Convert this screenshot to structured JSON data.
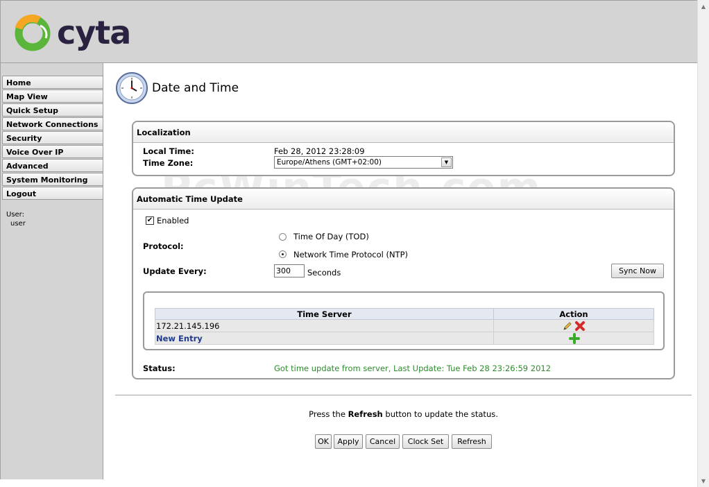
{
  "brand": {
    "logo_text": "cyta",
    "colors": {
      "green": "#5bb53a",
      "orange": "#f5a623",
      "navy": "#2a2240"
    }
  },
  "sidebar": {
    "items": [
      {
        "label": "Home"
      },
      {
        "label": "Map View"
      },
      {
        "label": "Quick Setup"
      },
      {
        "label": "Network Connections"
      },
      {
        "label": "Security"
      },
      {
        "label": "Voice Over IP"
      },
      {
        "label": "Advanced"
      },
      {
        "label": "System Monitoring"
      },
      {
        "label": "Logout"
      }
    ],
    "user_label": "User:",
    "user_name": "user"
  },
  "page": {
    "title": "Date and Time",
    "icon": "clock-icon"
  },
  "localization": {
    "heading": "Localization",
    "local_time_label": "Local Time:",
    "local_time_value": "Feb 28, 2012 23:28:09",
    "time_zone_label": "Time Zone:",
    "time_zone_value": "Europe/Athens (GMT+02:00)"
  },
  "automatic_update": {
    "heading": "Automatic Time Update",
    "enabled_label": "Enabled",
    "enabled_checked": true,
    "protocol_label": "Protocol:",
    "protocol_options": [
      {
        "label": "Time Of Day (TOD)",
        "selected": false
      },
      {
        "label": "Network Time Protocol (NTP)",
        "selected": true
      }
    ],
    "update_every_label": "Update Every:",
    "update_every_value": "300",
    "update_every_unit": "Seconds",
    "sync_now_label": "Sync Now",
    "table": {
      "headers": [
        "Time Server",
        "Action"
      ],
      "rows": [
        {
          "server": "172.21.145.196"
        }
      ],
      "new_entry_label": "New Entry"
    },
    "status_label": "Status:",
    "status_value": "Got time update from server, Last Update: Tue Feb 28 23:26:59 2012"
  },
  "footer": {
    "note_prefix": "Press the",
    "note_bold": "Refresh",
    "note_suffix": "button to update the status.",
    "buttons": {
      "ok": "OK",
      "apply": "Apply",
      "cancel": "Cancel",
      "clock_set": "Clock Set",
      "refresh": "Refresh"
    }
  },
  "watermark": "PcWinTech.com"
}
